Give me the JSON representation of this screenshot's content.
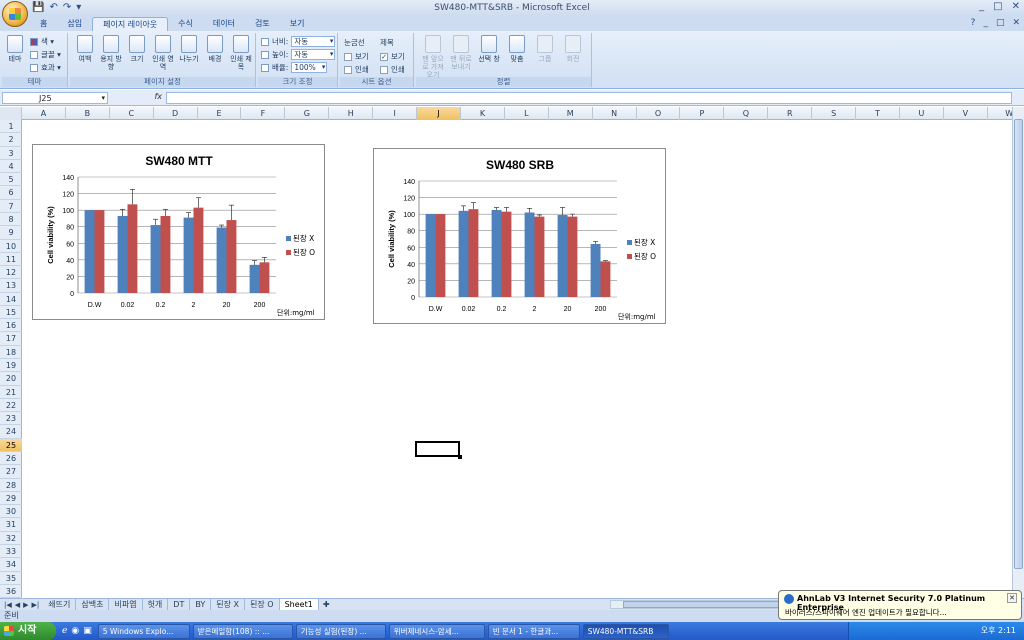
{
  "window": {
    "title": "SW480-MTT&SRB  -  Microsoft Excel",
    "controls": [
      "_",
      "□",
      "✕"
    ],
    "doc_controls": [
      "?",
      "_",
      "□",
      "✕"
    ]
  },
  "quick_access": [
    "💾",
    "↶",
    "↷",
    "▾"
  ],
  "ribbon_tabs": [
    "홈",
    "삽입",
    "페이지 레이아웃",
    "수식",
    "데이터",
    "검토",
    "보기"
  ],
  "active_tab": "페이지 레이아웃",
  "ribbon": {
    "theme": {
      "label": "테마",
      "buttons": [
        "테마"
      ],
      "small": [
        "색 ▾",
        "글꼴 ▾",
        "효과 ▾"
      ]
    },
    "page_setup": {
      "label": "페이지 설정",
      "buttons": [
        "여백",
        "용지 방향",
        "크기",
        "인쇄 영역",
        "나누기",
        "배경",
        "인쇄 제목"
      ]
    },
    "scale": {
      "label": "크기 조정",
      "width_label": "너비:",
      "width_value": "자동",
      "height_label": "높이:",
      "height_value": "자동",
      "scale_label": "배율:",
      "scale_value": "100%"
    },
    "sheet_options": {
      "label": "시트 옵션",
      "gridlines": "눈금선",
      "headings": "제목",
      "view": "보기",
      "print": "인쇄"
    },
    "arrange": {
      "label": "정렬",
      "buttons": [
        "맨 앞으로 가져오기",
        "맨 뒤로 보내기",
        "선택 창",
        "맞춤",
        "그룹",
        "회전"
      ]
    }
  },
  "formula_bar": {
    "name_box": "J25",
    "fx": "fx",
    "content": ""
  },
  "columns": [
    "A",
    "B",
    "C",
    "D",
    "E",
    "F",
    "G",
    "H",
    "I",
    "J",
    "K",
    "L",
    "M",
    "N",
    "O",
    "P",
    "Q",
    "R",
    "S",
    "T",
    "U",
    "V",
    "W"
  ],
  "active_column": "J",
  "rows": [
    "1",
    "2",
    "3",
    "4",
    "5",
    "6",
    "7",
    "8",
    "9",
    "10",
    "11",
    "12",
    "13",
    "14",
    "15",
    "16",
    "17",
    "18",
    "19",
    "20",
    "21",
    "22",
    "23",
    "24",
    "25",
    "26",
    "27",
    "28",
    "29",
    "30",
    "31",
    "32",
    "33",
    "34",
    "35",
    "36"
  ],
  "active_row": "25",
  "chart_data": [
    {
      "type": "bar",
      "title": "SW480 MTT",
      "ylabel": "Cell viability (%)",
      "xlabel": "",
      "unit_note": "단위:mg/ml",
      "categories": [
        "D.W",
        "0.02",
        "0.2",
        "2",
        "20",
        "200"
      ],
      "ylim": [
        0,
        140
      ],
      "yticks": [
        0,
        20,
        40,
        60,
        80,
        100,
        120,
        140
      ],
      "series": [
        {
          "name": "된장 X",
          "color": "#4f81bd",
          "values": [
            100,
            93,
            82,
            91,
            79,
            34
          ],
          "errors": [
            0,
            8,
            7,
            6,
            3,
            5
          ]
        },
        {
          "name": "된장 O",
          "color": "#c0504d",
          "values": [
            100,
            107,
            93,
            103,
            88,
            37
          ],
          "errors": [
            0,
            18,
            8,
            12,
            18,
            6
          ]
        }
      ],
      "legend": "right",
      "grid": true
    },
    {
      "type": "bar",
      "title": "SW480 SRB",
      "ylabel": "Cell viability (%)",
      "xlabel": "",
      "unit_note": "단위:mg/ml",
      "categories": [
        "D.W",
        "0.02",
        "0.2",
        "2",
        "20",
        "200"
      ],
      "ylim": [
        0,
        140
      ],
      "yticks": [
        0,
        20,
        40,
        60,
        80,
        100,
        120,
        140
      ],
      "series": [
        {
          "name": "된장 X",
          "color": "#4f81bd",
          "values": [
            100,
            104,
            105,
            102,
            99,
            64
          ],
          "errors": [
            0,
            6,
            3,
            5,
            9,
            3
          ]
        },
        {
          "name": "된장 O",
          "color": "#c0504d",
          "values": [
            100,
            106,
            103,
            97,
            97,
            43
          ],
          "errors": [
            0,
            8,
            5,
            2,
            3,
            1
          ]
        }
      ],
      "legend": "right",
      "grid": true
    }
  ],
  "sheet_tabs": [
    "쇄뜨기",
    "삼백초",
    "비파엽",
    "헛개",
    "DT",
    "BY",
    "된장 X",
    "된장 O",
    "Sheet1"
  ],
  "active_sheet": "Sheet1",
  "status": "준비",
  "taskbar": {
    "start": "시작",
    "tasks": [
      "5 Windows Explo...",
      "받은메일함(108) :: ...",
      "기능성 실험(된장) ...",
      "위버제네시스-암세...",
      "빈 문서 1 - 한글과...",
      "SW480-MTT&SRB"
    ],
    "active_task": "SW480-MTT&SRB",
    "clock": "오후 2:11"
  },
  "notification": {
    "title": "AhnLab V3 Internet Security 7.0 Platinum Enterprise",
    "body": "바이러스/스파이웨어 엔진 업데이트가 필요합니다..."
  }
}
